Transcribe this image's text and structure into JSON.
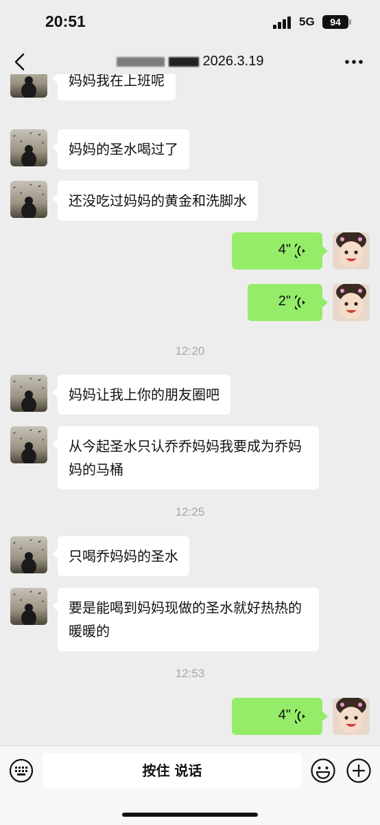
{
  "status_bar": {
    "time": "20:51",
    "network": "5G",
    "battery": "94"
  },
  "header": {
    "title": "2026.3.19"
  },
  "messages": [
    {
      "text": "妈妈我在上班呢"
    },
    {
      "text": "妈妈的圣水喝过了"
    },
    {
      "text": "还没吃过妈妈的黄金和洗脚水"
    },
    {
      "voice_duration": "4\""
    },
    {
      "voice_duration": "2\""
    },
    {
      "timestamp": "12:20"
    },
    {
      "text": "妈妈让我上你的朋友圈吧"
    },
    {
      "text": "从今起圣水只认乔乔妈妈我要成为乔妈妈的马桶"
    },
    {
      "timestamp": "12:25"
    },
    {
      "text": "只喝乔妈妈的圣水"
    },
    {
      "text": "要是能喝到妈妈现做的圣水就好热热的暖暖的"
    },
    {
      "timestamp": "12:53"
    },
    {
      "voice_duration": "4\""
    }
  ],
  "input_bar": {
    "hold_to_talk_label": "按住 说话"
  },
  "colors": {
    "background": "#ededed",
    "sent_bubble": "#95ec69",
    "received_bubble": "#ffffff",
    "timestamp": "#a6a6a6"
  },
  "icons": [
    "back-arrow-icon",
    "more-icon",
    "voice-wave-icon",
    "keyboard-icon",
    "emoji-icon",
    "plus-icon",
    "signal-icon",
    "battery-icon"
  ]
}
